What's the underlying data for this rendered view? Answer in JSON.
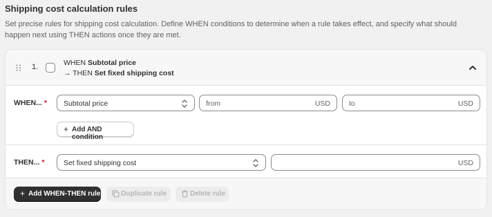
{
  "header": {
    "title": "Shipping cost calculation rules",
    "description": "Set precise rules for shipping cost calculation. Define WHEN conditions to determine when a rule takes effect, and specify what should happen next using THEN actions once they are met."
  },
  "rule": {
    "index": "1.",
    "summary_when_prefix": "WHEN ",
    "summary_when_value": "Subtotal price",
    "summary_then_prefix": "→ THEN ",
    "summary_then_value": "Set fixed shipping cost",
    "checked": false,
    "expanded": true
  },
  "when_row": {
    "label": "WHEN...",
    "required_mark": "*",
    "condition_select": "Subtotal price",
    "from_placeholder": "from",
    "from_suffix": "USD",
    "to_placeholder": "to",
    "to_suffix": "USD",
    "add_and_label": "Add AND condition",
    "add_icon": "+"
  },
  "then_row": {
    "label": "THEN...",
    "required_mark": "*",
    "action_select": "Set fixed shipping cost",
    "amount_value": "",
    "amount_suffix": "USD"
  },
  "footer": {
    "add_rule_label": "Add WHEN-THEN rule",
    "add_icon": "+",
    "duplicate_label": "Duplicate rule",
    "delete_label": "Delete rule"
  },
  "icons": {
    "drag": "drag-handle-icon",
    "collapse": "chevron-up-icon",
    "select": "select-chevron-icon",
    "duplicate": "duplicate-icon",
    "delete": "trash-icon"
  },
  "colors": {
    "background": "#f1f1f1",
    "card": "#ffffff",
    "primary_button": "#303030",
    "required": "#c70a24",
    "disabled_text": "#b5b5b5"
  }
}
